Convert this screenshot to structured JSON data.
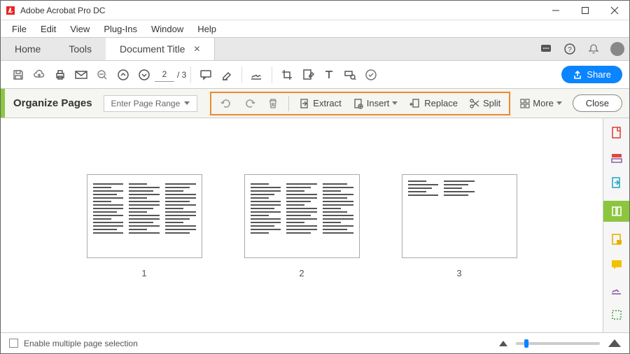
{
  "app": {
    "title": "Adobe Acrobat Pro DC"
  },
  "menu": {
    "file": "File",
    "edit": "Edit",
    "view": "View",
    "plugins": "Plug-Ins",
    "window": "Window",
    "help": "Help"
  },
  "tabs": {
    "home": "Home",
    "tools": "Tools",
    "doc": "Document Title"
  },
  "toolbar": {
    "page_current": "2",
    "page_total": "/ 3",
    "share_label": "Share"
  },
  "organize": {
    "title": "Organize Pages",
    "range_label": "Enter Page Range",
    "extract": "Extract",
    "insert": "Insert",
    "replace": "Replace",
    "split": "Split",
    "more": "More",
    "close": "Close"
  },
  "pages": {
    "p1": "1",
    "p2": "2",
    "p3": "3"
  },
  "footer": {
    "enable_multi": "Enable multiple page selection"
  }
}
